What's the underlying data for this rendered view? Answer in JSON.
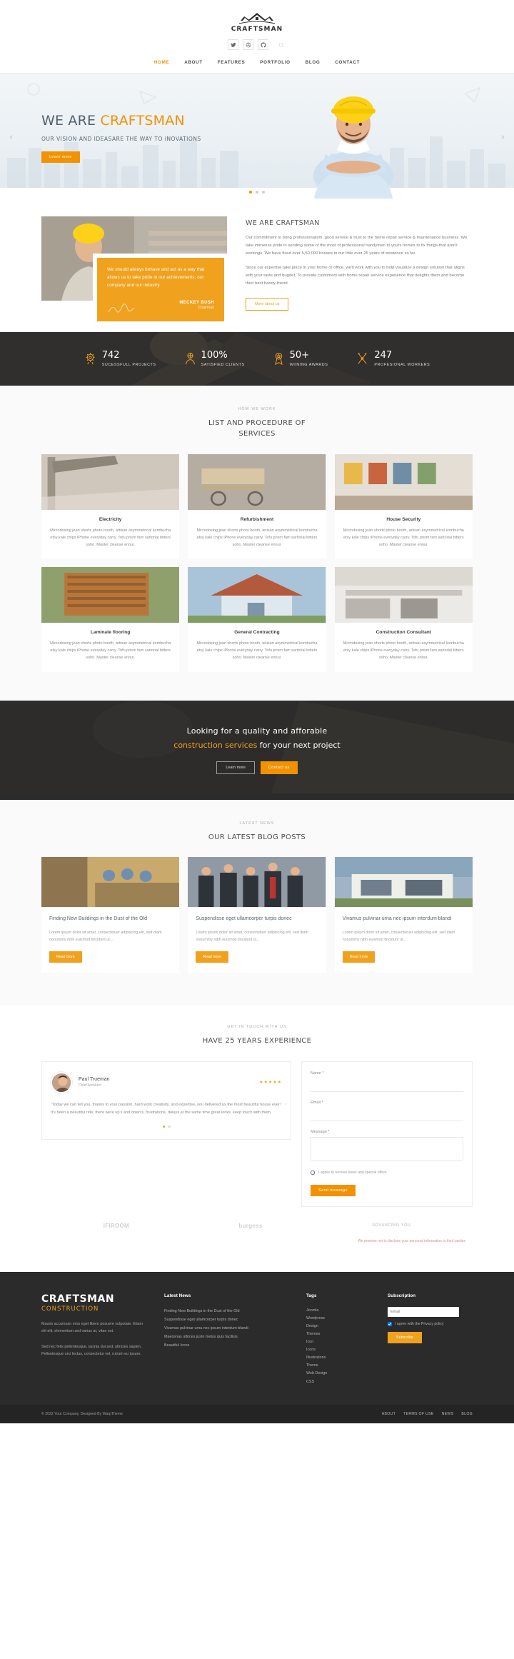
{
  "header": {
    "logo_text": "CRAFTSMAN",
    "social": [
      {
        "name": "twitter-icon",
        "label": "Twitter"
      },
      {
        "name": "dribbble-icon",
        "label": "Dribbble"
      },
      {
        "name": "github-icon",
        "label": "GitHub"
      }
    ],
    "search_label": "Search",
    "nav": [
      {
        "label": "HOME",
        "active": true
      },
      {
        "label": "ABOUT",
        "active": false
      },
      {
        "label": "FEATURES",
        "active": false
      },
      {
        "label": "PORTFOLIO",
        "active": false
      },
      {
        "label": "BLOG",
        "active": false
      },
      {
        "label": "CONTACT",
        "active": false
      }
    ]
  },
  "hero": {
    "title_plain": "WE ARE ",
    "title_accent": "CRAFTSMAN",
    "subtitle": "OUR VISION AND IDEASARE THE WAY TO INOVATIONS",
    "button": "Learn more",
    "prev_arrow": "‹",
    "next_arrow": "›",
    "slides": 3,
    "active_slide": 1
  },
  "about": {
    "quote": "We should always behave and act as a way that allows us to take pride in our achievements, our company and our industry.",
    "quote_name": "MECKEY BUSH",
    "quote_role": "Chairman",
    "heading": "WE ARE CRAFTSMAN",
    "p1": "Our commitment to bring professionalism, good service & trust to the home repair service & maintenance business. We take immense pride in sending some of the most of professional handymen to yours homes to fix things that aren't workings. We have fixed over 5,50,000 houses in our little over 25 years of existence so far.",
    "p2": "Since our expertise take place in your home or office, we'll work with you to help visualize a design solution that aligns with your taste and bugdet, To provide customers with home repair service experience that delights them and become their best handy-friend.",
    "button": "More about us"
  },
  "stats": [
    {
      "icon": "gear-icon",
      "value": "742",
      "label": "SUCESSFULL PROJECTS"
    },
    {
      "icon": "person-icon",
      "value": "100%",
      "label": "SATISFIED CLIENTS"
    },
    {
      "icon": "award-icon",
      "value": "50+",
      "label": "WIINING AWARDS"
    },
    {
      "icon": "tools-icon",
      "value": "247",
      "label": "PROFESIONAL WORKERS"
    }
  ],
  "services": {
    "eyebrow": "HOW WE WORK",
    "title_line1": "LIST AND PROCEDURE OF",
    "title_line2": "SERVICES",
    "body": "Microdosing jean shorts photo booth, artisan asymmetrical kombucha etsy kale chips iPhone everyday carry. Tofu prism fam sartorial bitters soho. Master cleanse ennui.",
    "items": [
      {
        "title": "Electricity"
      },
      {
        "title": "Refurbishment"
      },
      {
        "title": "House Security"
      },
      {
        "title": "Laminate flooring"
      },
      {
        "title": "General Contracting"
      },
      {
        "title": "Construction Consultant"
      }
    ]
  },
  "cta": {
    "line1": "Looking for a quality and afforable",
    "line2_accent": "construction services",
    "line2_rest": " for your next project",
    "btn_left": "Learn more",
    "btn_right": "Contact us"
  },
  "blog": {
    "eyebrow": "LATEST NEWS",
    "title": "OUR LATEST BLOG POSTS",
    "read_more": "Read more",
    "posts": [
      {
        "title": "Finding New Buildings in the Dust of the Old",
        "excerpt": "Lorem ipsum dolor sit amet, consectetuer adipiscing elit, sed diam nonummy nibh euismod tincidunt ut..."
      },
      {
        "title": "Suspendisse eget ullamcorper turpis donec",
        "excerpt": "Lorem ipsum dolor sit amet, consectetuer adipiscing elit, sed diam nonummy nibh euismod tincidunt ut..."
      },
      {
        "title": "Vivamus pulvinar urna nec ipsum interdum blandi",
        "excerpt": "Lorem ipsum dolor sit amet, consectetuer adipiscing elit, sed diam nonummy nibh euismod tincidunt ut..."
      }
    ]
  },
  "contact": {
    "eyebrow": "GET IN TOUCH WITH US",
    "title": "HAVE 25 YEARS EXPERIENCE",
    "testimonial": {
      "name": "Paul Trueman",
      "role": "Chief Architect",
      "stars": "★★★★★",
      "quote": "“Today we can tell you, thanks to your passion, hard work creativity, and expertise, you delivered us the most beautiful house ever! It's been a beautiful ride, there were up's and down's, frustrations, delays at the same time great looks. keep touch with them.",
      "next_arrow": "›"
    },
    "form": {
      "name_label": "Name *",
      "email_label": "Email *",
      "message_label": "Message *",
      "consent": "I agree to receive news and special offers",
      "submit": "Send message"
    },
    "brands": [
      "IFIROOM",
      "burgess",
      "ADVANCING YOU"
    ],
    "disclaimer": "We promise not to disclose your personal information to third parties"
  },
  "footer": {
    "logo": "CRAFTSMAN",
    "logo_sub": "CONSTRUCTION",
    "p1": "Mauris accumsan eros eget libero posuere vulputate. Etiam elit elit, elementum sed varius at, vitae est.",
    "p2": "Sed nec felis pellentesque, lacinia dui sed, ultricies sapien. Pellentesque orci lectus, consectetur vel, rutrum eu ipsum.",
    "news_heading": "Latest News",
    "news": [
      "Finding New Buildings in the Dust of the Old",
      "Suspendisse eget ullamcorper turpis donec",
      "Vivamus pulvinar urna nec ipsum interdum blandi",
      "Maecenas ultrices justo metus quis facilisis",
      "Beautiful Icons"
    ],
    "tags_heading": "Tags",
    "tags": [
      "Joomla",
      "Wordpress",
      "Design",
      "Themes",
      "Icon",
      "Icons",
      "Illustrations",
      "Theme",
      "Web Design",
      "CSS"
    ],
    "sub_heading": "Subscription",
    "sub_placeholder": "Email",
    "sub_consent": "I agree with the Privacy policy",
    "sub_button": "Subscribe",
    "copyright": "© 2022 Your Company. Designed By WarpTheme",
    "bottom_links": [
      "ABOUT",
      "TERMS OF USE",
      "NEWS",
      "BLOG"
    ]
  }
}
